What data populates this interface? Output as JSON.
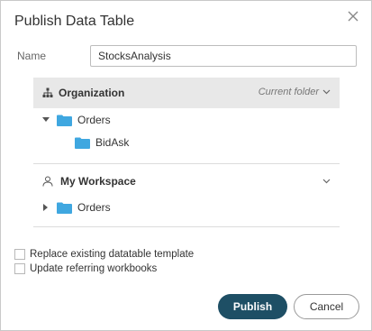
{
  "dialog": {
    "title": "Publish Data Table",
    "close_icon": "close-icon"
  },
  "name_field": {
    "label": "Name",
    "value": "StocksAnalysis"
  },
  "organization": {
    "label": "Organization",
    "current_folder": "Current folder",
    "icon": "organization-icon",
    "items": [
      {
        "label": "Orders",
        "expanded": true
      },
      {
        "label": "BidAsk"
      }
    ]
  },
  "workspace": {
    "label": "My Workspace",
    "icon": "user-icon",
    "items": [
      {
        "label": "Orders",
        "expanded": false
      }
    ]
  },
  "options": {
    "replace_template": "Replace existing datatable template",
    "update_workbooks": "Update referring workbooks"
  },
  "buttons": {
    "publish": "Publish",
    "cancel": "Cancel"
  },
  "colors": {
    "primary": "#1e4f65",
    "folder": "#3fa7e0"
  }
}
